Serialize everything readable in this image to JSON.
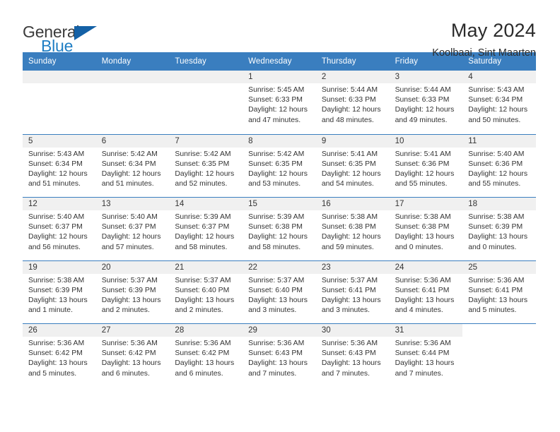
{
  "brand": {
    "word_one": "General",
    "word_two": "Blue",
    "logo_icon": "triangle-logo-icon"
  },
  "header": {
    "month_title": "May 2024",
    "location": "Koolbaai, Sint Maarten"
  },
  "colors": {
    "header_blue": "#3a7ebf",
    "brand_blue": "#1f7ec4",
    "logo_blue": "#1461a6",
    "day_strip_gray": "#f0f0f0",
    "text": "#333333"
  },
  "weekdays": [
    "Sunday",
    "Monday",
    "Tuesday",
    "Wednesday",
    "Thursday",
    "Friday",
    "Saturday"
  ],
  "weeks": [
    [
      {
        "day": "",
        "lines": []
      },
      {
        "day": "",
        "lines": []
      },
      {
        "day": "",
        "lines": []
      },
      {
        "day": "1",
        "lines": [
          "Sunrise: 5:45 AM",
          "Sunset: 6:33 PM",
          "Daylight: 12 hours",
          "and 47 minutes."
        ]
      },
      {
        "day": "2",
        "lines": [
          "Sunrise: 5:44 AM",
          "Sunset: 6:33 PM",
          "Daylight: 12 hours",
          "and 48 minutes."
        ]
      },
      {
        "day": "3",
        "lines": [
          "Sunrise: 5:44 AM",
          "Sunset: 6:33 PM",
          "Daylight: 12 hours",
          "and 49 minutes."
        ]
      },
      {
        "day": "4",
        "lines": [
          "Sunrise: 5:43 AM",
          "Sunset: 6:34 PM",
          "Daylight: 12 hours",
          "and 50 minutes."
        ]
      }
    ],
    [
      {
        "day": "5",
        "lines": [
          "Sunrise: 5:43 AM",
          "Sunset: 6:34 PM",
          "Daylight: 12 hours",
          "and 51 minutes."
        ]
      },
      {
        "day": "6",
        "lines": [
          "Sunrise: 5:42 AM",
          "Sunset: 6:34 PM",
          "Daylight: 12 hours",
          "and 51 minutes."
        ]
      },
      {
        "day": "7",
        "lines": [
          "Sunrise: 5:42 AM",
          "Sunset: 6:35 PM",
          "Daylight: 12 hours",
          "and 52 minutes."
        ]
      },
      {
        "day": "8",
        "lines": [
          "Sunrise: 5:42 AM",
          "Sunset: 6:35 PM",
          "Daylight: 12 hours",
          "and 53 minutes."
        ]
      },
      {
        "day": "9",
        "lines": [
          "Sunrise: 5:41 AM",
          "Sunset: 6:35 PM",
          "Daylight: 12 hours",
          "and 54 minutes."
        ]
      },
      {
        "day": "10",
        "lines": [
          "Sunrise: 5:41 AM",
          "Sunset: 6:36 PM",
          "Daylight: 12 hours",
          "and 55 minutes."
        ]
      },
      {
        "day": "11",
        "lines": [
          "Sunrise: 5:40 AM",
          "Sunset: 6:36 PM",
          "Daylight: 12 hours",
          "and 55 minutes."
        ]
      }
    ],
    [
      {
        "day": "12",
        "lines": [
          "Sunrise: 5:40 AM",
          "Sunset: 6:37 PM",
          "Daylight: 12 hours",
          "and 56 minutes."
        ]
      },
      {
        "day": "13",
        "lines": [
          "Sunrise: 5:40 AM",
          "Sunset: 6:37 PM",
          "Daylight: 12 hours",
          "and 57 minutes."
        ]
      },
      {
        "day": "14",
        "lines": [
          "Sunrise: 5:39 AM",
          "Sunset: 6:37 PM",
          "Daylight: 12 hours",
          "and 58 minutes."
        ]
      },
      {
        "day": "15",
        "lines": [
          "Sunrise: 5:39 AM",
          "Sunset: 6:38 PM",
          "Daylight: 12 hours",
          "and 58 minutes."
        ]
      },
      {
        "day": "16",
        "lines": [
          "Sunrise: 5:38 AM",
          "Sunset: 6:38 PM",
          "Daylight: 12 hours",
          "and 59 minutes."
        ]
      },
      {
        "day": "17",
        "lines": [
          "Sunrise: 5:38 AM",
          "Sunset: 6:38 PM",
          "Daylight: 13 hours",
          "and 0 minutes."
        ]
      },
      {
        "day": "18",
        "lines": [
          "Sunrise: 5:38 AM",
          "Sunset: 6:39 PM",
          "Daylight: 13 hours",
          "and 0 minutes."
        ]
      }
    ],
    [
      {
        "day": "19",
        "lines": [
          "Sunrise: 5:38 AM",
          "Sunset: 6:39 PM",
          "Daylight: 13 hours",
          "and 1 minute."
        ]
      },
      {
        "day": "20",
        "lines": [
          "Sunrise: 5:37 AM",
          "Sunset: 6:39 PM",
          "Daylight: 13 hours",
          "and 2 minutes."
        ]
      },
      {
        "day": "21",
        "lines": [
          "Sunrise: 5:37 AM",
          "Sunset: 6:40 PM",
          "Daylight: 13 hours",
          "and 2 minutes."
        ]
      },
      {
        "day": "22",
        "lines": [
          "Sunrise: 5:37 AM",
          "Sunset: 6:40 PM",
          "Daylight: 13 hours",
          "and 3 minutes."
        ]
      },
      {
        "day": "23",
        "lines": [
          "Sunrise: 5:37 AM",
          "Sunset: 6:41 PM",
          "Daylight: 13 hours",
          "and 3 minutes."
        ]
      },
      {
        "day": "24",
        "lines": [
          "Sunrise: 5:36 AM",
          "Sunset: 6:41 PM",
          "Daylight: 13 hours",
          "and 4 minutes."
        ]
      },
      {
        "day": "25",
        "lines": [
          "Sunrise: 5:36 AM",
          "Sunset: 6:41 PM",
          "Daylight: 13 hours",
          "and 5 minutes."
        ]
      }
    ],
    [
      {
        "day": "26",
        "lines": [
          "Sunrise: 5:36 AM",
          "Sunset: 6:42 PM",
          "Daylight: 13 hours",
          "and 5 minutes."
        ]
      },
      {
        "day": "27",
        "lines": [
          "Sunrise: 5:36 AM",
          "Sunset: 6:42 PM",
          "Daylight: 13 hours",
          "and 6 minutes."
        ]
      },
      {
        "day": "28",
        "lines": [
          "Sunrise: 5:36 AM",
          "Sunset: 6:42 PM",
          "Daylight: 13 hours",
          "and 6 minutes."
        ]
      },
      {
        "day": "29",
        "lines": [
          "Sunrise: 5:36 AM",
          "Sunset: 6:43 PM",
          "Daylight: 13 hours",
          "and 7 minutes."
        ]
      },
      {
        "day": "30",
        "lines": [
          "Sunrise: 5:36 AM",
          "Sunset: 6:43 PM",
          "Daylight: 13 hours",
          "and 7 minutes."
        ]
      },
      {
        "day": "31",
        "lines": [
          "Sunrise: 5:36 AM",
          "Sunset: 6:44 PM",
          "Daylight: 13 hours",
          "and 7 minutes."
        ]
      },
      {
        "day": "",
        "lines": []
      }
    ]
  ]
}
